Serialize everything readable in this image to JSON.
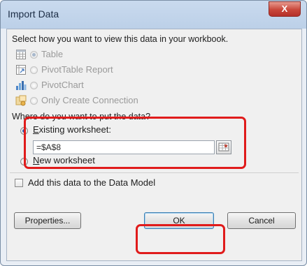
{
  "dialog": {
    "title": "Import Data",
    "close_glyph": "X"
  },
  "view_section": {
    "prompt": "Select how you want to view this data in your workbook.",
    "options": [
      {
        "label": "Table",
        "icon": "table-icon",
        "selected": true,
        "enabled": false
      },
      {
        "label": "PivotTable Report",
        "icon": "pivottable-icon",
        "selected": false,
        "enabled": false
      },
      {
        "label": "PivotChart",
        "icon": "pivotchart-icon",
        "selected": false,
        "enabled": false
      },
      {
        "label": "Only Create Connection",
        "icon": "connection-icon",
        "selected": false,
        "enabled": false
      }
    ]
  },
  "location_section": {
    "prompt": "Where do you want to put the data?",
    "existing_label": "Existing worksheet:",
    "existing_selected": true,
    "cell_value": "=$A$8",
    "new_label": "New worksheet",
    "new_selected": false
  },
  "data_model": {
    "label": "Add this data to the Data Model",
    "checked": false
  },
  "buttons": {
    "properties": "Properties...",
    "ok": "OK",
    "cancel": "Cancel"
  },
  "colors": {
    "highlight": "#e01b1b",
    "title_bar": "#bcd0e8",
    "close_button": "#c9473a"
  }
}
